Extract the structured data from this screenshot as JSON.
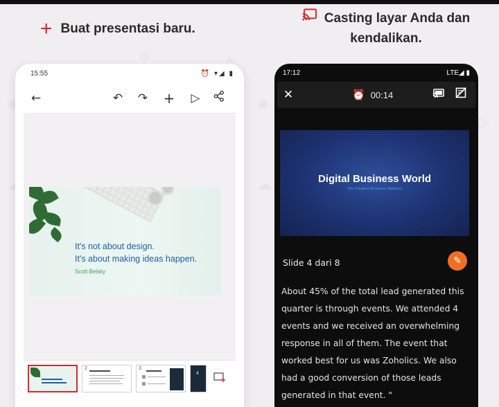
{
  "left": {
    "heading": "Buat presentasi baru.",
    "status_time": "15:55",
    "status_icons": "⏰ ▾◢ ▮",
    "toolbar": {
      "back_icon": "←",
      "undo_icon": "↶",
      "redo_icon": "↷",
      "add_icon": "+",
      "play_icon": "▷",
      "share_icon": "share-icon"
    },
    "slide": {
      "quote_line1": "It's not about design.",
      "quote_line2": "It's about making ideas happen.",
      "author": "Scott Belsky"
    },
    "thumbnails": [
      "1",
      "2",
      "3",
      "4"
    ]
  },
  "right": {
    "heading": "Casting layar Anda dan kendalikan.",
    "status_time": "17:12",
    "status_icons": "LTE◢ ▮",
    "timer": "00:14",
    "slide": {
      "title": "Digital Business World",
      "subtitle": "The Creators Business Statistics"
    },
    "slide_count": "Slide 4 dari 8",
    "notes": "About 45% of the total lead generated this quarter is through events. We attended 4 events and we received an overwhelming response in all of them.  The event that worked best for us was Zoholics. We also had a good conversion of those leads generated in that event. \""
  },
  "colors": {
    "accent_red": "#d9272f",
    "timer_green": "#52c26c",
    "edit_orange": "#f26f22",
    "slide_blue": "#1d3272",
    "quote_blue": "#1f5fa8"
  }
}
